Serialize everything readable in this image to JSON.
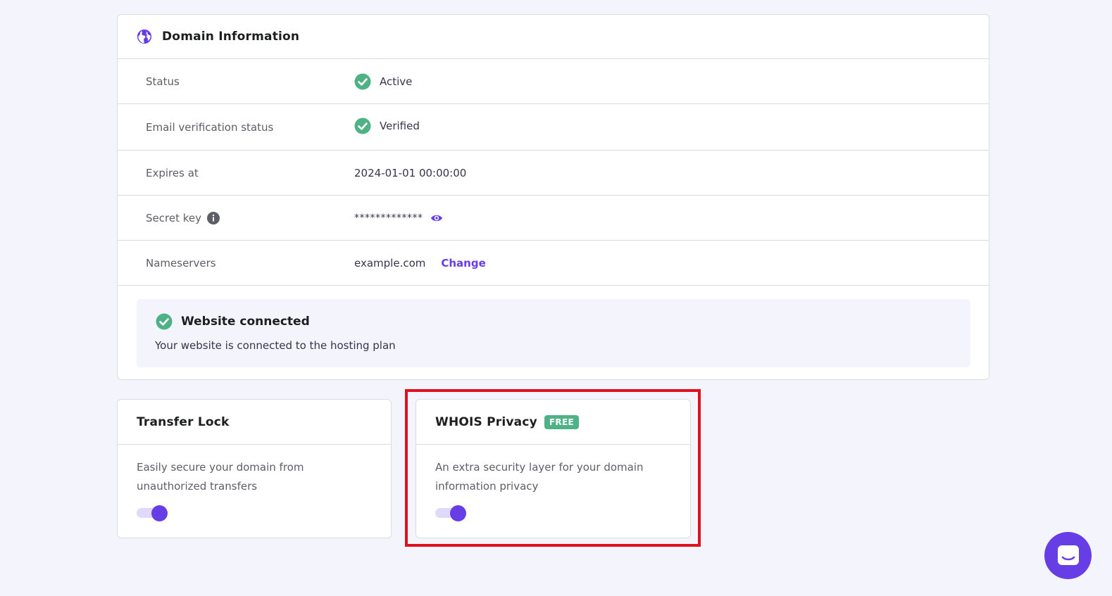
{
  "domain_info": {
    "title": "Domain Information",
    "rows": [
      {
        "label": "Status",
        "value": "Active"
      },
      {
        "label": "Email verification status",
        "value": "Verified"
      },
      {
        "label": "Expires at",
        "value": "2024-01-01 00:00:00"
      },
      {
        "label": "Secret key",
        "value": "*************"
      },
      {
        "label": "Nameservers",
        "value": "example.com",
        "action": "Change"
      }
    ],
    "website_connected": {
      "title": "Website connected",
      "description": "Your website is connected to the hosting plan"
    }
  },
  "transfer_lock": {
    "title": "Transfer Lock",
    "description": "Easily secure your domain from unauthorized transfers",
    "enabled": true
  },
  "whois_privacy": {
    "title": "WHOIS Privacy",
    "badge": "FREE",
    "description": "An extra security layer for your domain information privacy",
    "enabled": true
  },
  "colors": {
    "accent": "#673de6",
    "success": "#4fb286",
    "highlight": "#e0101e"
  },
  "icons": [
    "globe-icon",
    "check-circle-icon",
    "info-icon",
    "eye-icon",
    "chat-icon"
  ]
}
